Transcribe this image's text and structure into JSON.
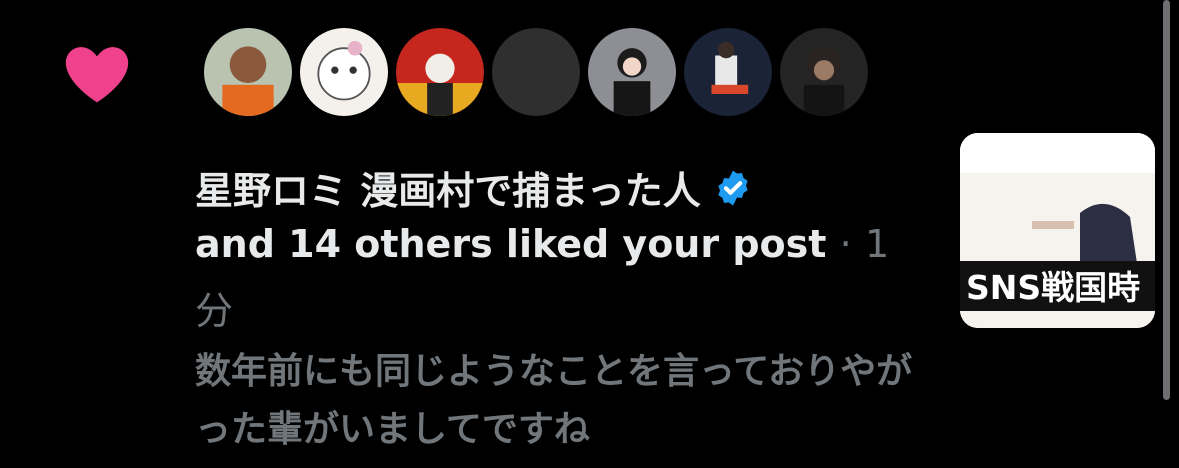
{
  "notification": {
    "icon": "heart-icon",
    "accent": "#f91880",
    "user_name": "星野ロミ 漫画村で捕まった人",
    "verified_icon": "verified-badge-icon",
    "verified_color": "#1d9bf0",
    "action_text": "and 14 others liked your post",
    "separator": "·",
    "time_part1": "1",
    "time_part2": "分",
    "excerpt": "数年前にも同じようなことを言っておりやがった輩がいましてですね",
    "thumbnail_caption": "SNS戦国時"
  },
  "avatars": [
    {
      "name": "avatar-1"
    },
    {
      "name": "avatar-2"
    },
    {
      "name": "avatar-3"
    },
    {
      "name": "avatar-4"
    },
    {
      "name": "avatar-5"
    },
    {
      "name": "avatar-6"
    },
    {
      "name": "avatar-7"
    }
  ]
}
